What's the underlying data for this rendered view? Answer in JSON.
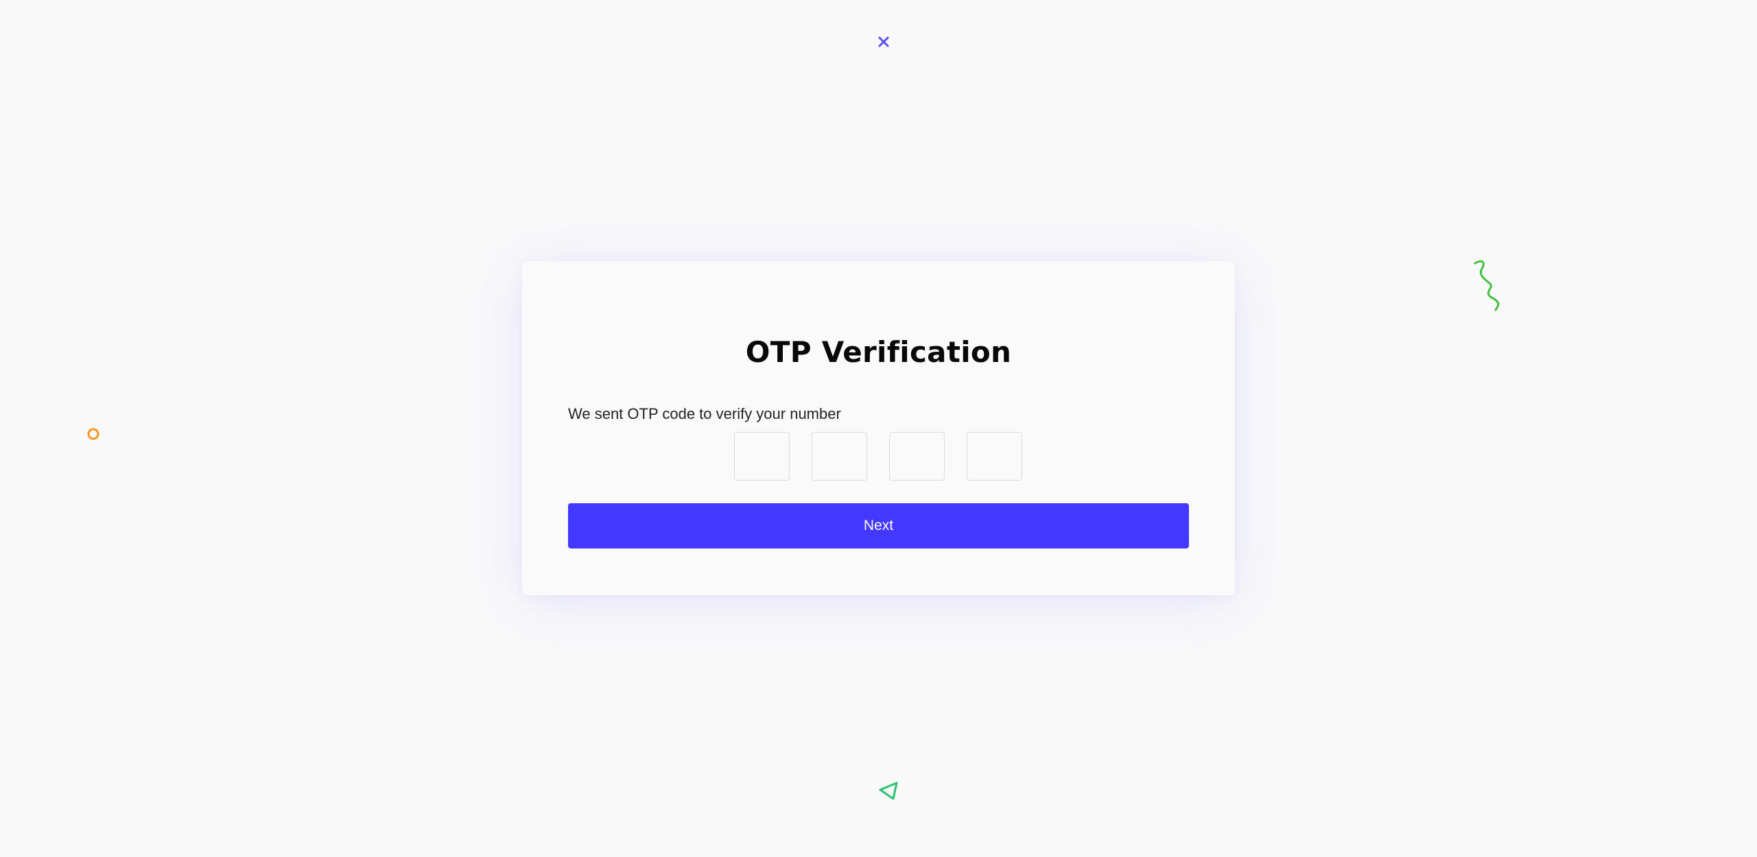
{
  "title": "OTP Verification",
  "subtitle": "We sent OTP code to verify your number",
  "otp": {
    "digits": [
      "",
      "",
      "",
      ""
    ]
  },
  "next_label": "Next",
  "colors": {
    "accent": "#4238ff",
    "background": "#f9f9fa",
    "deco_x": "#5a4ff0",
    "deco_circle": "#f7941d",
    "deco_squiggle": "#3fc13f",
    "deco_triangle": "#2fbf71"
  },
  "decorations": [
    "x-icon",
    "circle-icon",
    "squiggle-icon",
    "triangle-icon"
  ]
}
